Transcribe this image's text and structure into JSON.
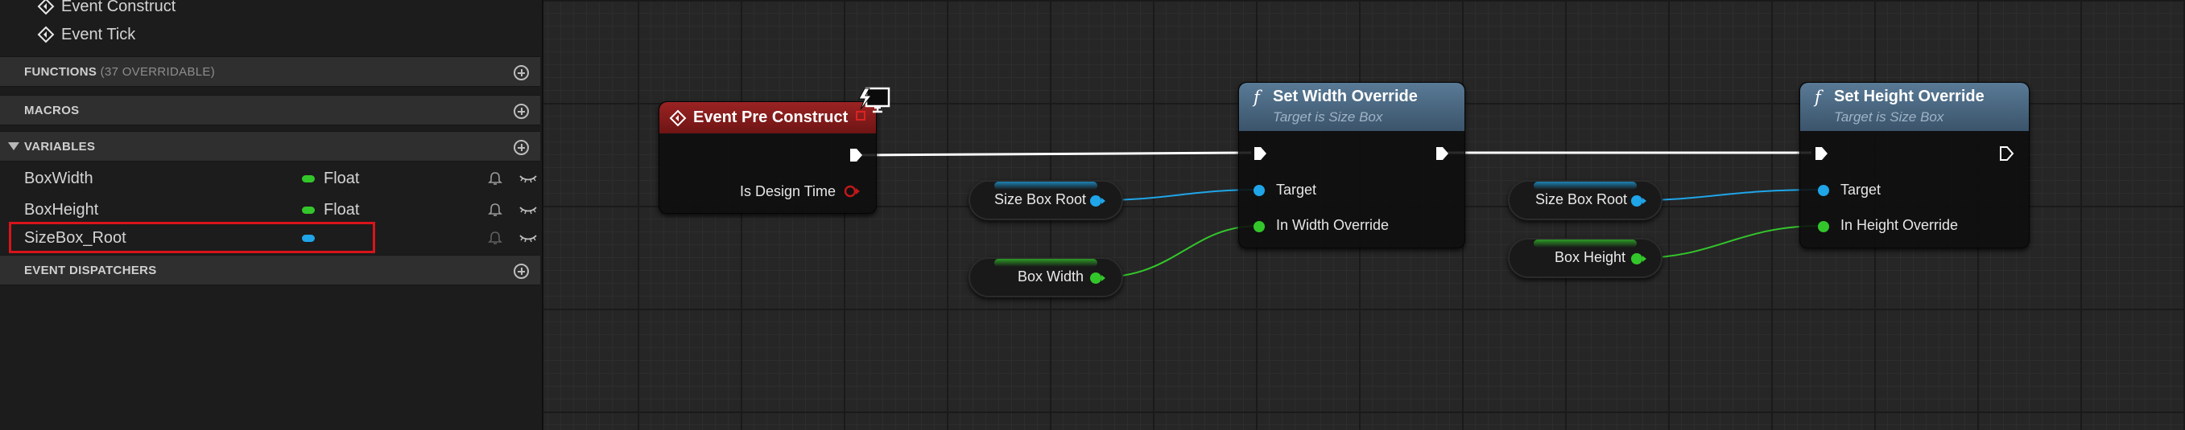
{
  "panel": {
    "graphs": [
      {
        "label": "Event Construct"
      },
      {
        "label": "Event Tick"
      }
    ],
    "sections": {
      "functions": {
        "title": "FUNCTIONS",
        "suffix": "(37 OVERRIDABLE)"
      },
      "macros": {
        "title": "MACROS"
      },
      "variables": {
        "title": "VARIABLES"
      },
      "dispatchers": {
        "title": "EVENT DISPATCHERS"
      }
    },
    "variables": [
      {
        "name": "BoxWidth",
        "type": "Float",
        "color": "#33c62b"
      },
      {
        "name": "BoxHeight",
        "type": "Float",
        "color": "#33c62b"
      },
      {
        "name": "SizeBox_Root",
        "type": "",
        "color": "#1fa5e8",
        "selected": true
      }
    ]
  },
  "graph": {
    "event_node": {
      "title": "Event Pre Construct",
      "pin_design_time": "Is Design Time",
      "header_color": "#8e1b1b"
    },
    "set_width_node": {
      "title": "Set Width Override",
      "subtitle": "Target is Size Box",
      "pin_target": "Target",
      "pin_value": "In Width Override",
      "icon": "f"
    },
    "set_height_node": {
      "title": "Set Height Override",
      "subtitle": "Target is Size Box",
      "pin_target": "Target",
      "pin_value": "In Height Override",
      "icon": "f"
    },
    "var_nodes": {
      "sizebox_root_1": "Size Box Root",
      "box_width": "Box Width",
      "sizebox_root_2": "Size Box Root",
      "box_height": "Box Height"
    }
  },
  "colors": {
    "object_pin": "#1fa5e8",
    "float_pin": "#33c62b",
    "exec_pin": "#ffffff",
    "bool_pin": "#a11414",
    "function_header": "#4e6a84",
    "selection_outline": "#d9141b"
  },
  "icons": [
    "event-diamond-icon",
    "add-circle-icon",
    "bell-icon",
    "eye-closed-icon",
    "function-icon",
    "exec-pin-icon",
    "monitor-lightning-icon"
  ]
}
